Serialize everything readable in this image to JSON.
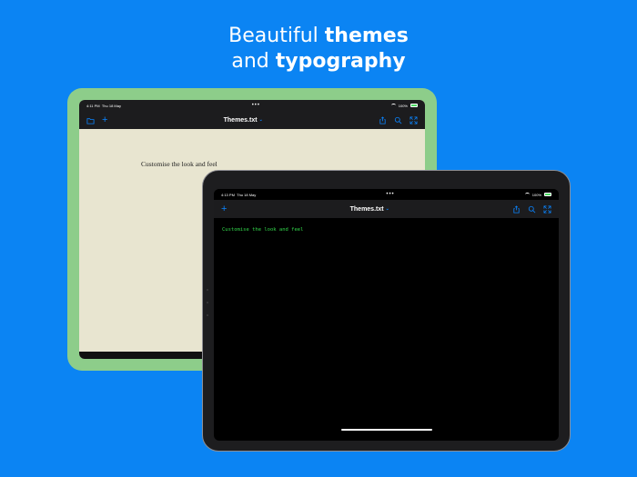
{
  "headline": {
    "line1_normal": "Beautiful ",
    "line1_bold": "themes",
    "line2_normal": "and ",
    "line2_bold": "typography"
  },
  "back_device": {
    "status": {
      "time": "4:11 PM",
      "date": "Thu 18 May",
      "dots": "•••",
      "battery": "100%"
    },
    "toolbar": {
      "title": "Themes.txt",
      "chevron": "⌄",
      "icons_left": [
        "folder-icon",
        "plus-icon"
      ],
      "icons_right": [
        "share-icon",
        "search-icon",
        "fullscreen-icon"
      ]
    },
    "content": "Customise the look and feel",
    "colors": {
      "frame": "#8dcd8a",
      "page": "#e8e5d0"
    }
  },
  "front_device": {
    "status": {
      "time": "4:13 PM",
      "date": "Thu 18 May",
      "dots": "•••",
      "battery": "100%"
    },
    "toolbar": {
      "title": "Themes.txt",
      "chevron": "⌄",
      "icons_left": [
        "plus-icon"
      ],
      "icons_right": [
        "share-icon",
        "search-icon",
        "fullscreen-icon"
      ]
    },
    "content": "Customise the look and feel",
    "colors": {
      "frame": "#1d1d1f",
      "page": "#000000",
      "text": "#32d74b"
    }
  },
  "colors": {
    "background": "#0b84f3",
    "accent": "#0a84ff"
  }
}
